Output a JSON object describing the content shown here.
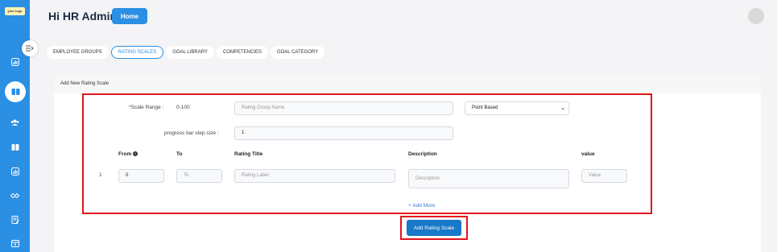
{
  "sidebar": {
    "logo_text": "your logo",
    "icons": [
      "chart-icon",
      "book-icon",
      "team-icon",
      "book-open-icon",
      "report-icon",
      "handshake-icon",
      "edit-doc-icon",
      "calendar-icon"
    ]
  },
  "header": {
    "greeting": "Hi HR Admin",
    "home_label": "Home"
  },
  "tabs": [
    {
      "label": "EMPLOYEE GROUPS",
      "active": false
    },
    {
      "label": "RATING SCALES",
      "active": true
    },
    {
      "label": "GOAL LIBRARY",
      "active": false
    },
    {
      "label": "COMPETENCIES",
      "active": false
    },
    {
      "label": "GOAL CATEGORY",
      "active": false
    }
  ],
  "form": {
    "section_title": "Add New Rating Scale",
    "scale_range_label": "*Scale Range :",
    "scale_range_value": "0-100",
    "group_name_placeholder": "Rating Group Name",
    "type_selected": "Point Based",
    "step_label": "progress bar step size :",
    "step_value": "1",
    "columns": {
      "from": "From",
      "to": "To",
      "title": "Rating Title",
      "description": "Description",
      "value": "value"
    },
    "row": {
      "index": "1",
      "from_value": "0",
      "to_placeholder": "To",
      "title_placeholder": "Rating Label",
      "description_placeholder": "Description",
      "value_placeholder": "Value"
    },
    "add_more": "+ Add More",
    "submit_label": "Add Rating Scale"
  },
  "colors": {
    "accent": "#2b8fe3",
    "highlight": "#e1141c"
  }
}
